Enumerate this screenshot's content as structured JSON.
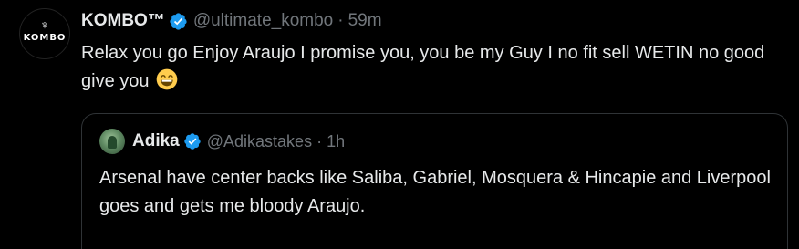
{
  "tweet": {
    "author": {
      "name": "KOMBO™",
      "handle": "@ultimate_kombo",
      "avatar_text": "KOMBO",
      "avatar_icon": "palm-tree-icon"
    },
    "separator": "·",
    "time": "59m",
    "text": "Relax you go Enjoy Araujo I promise you, you be my Guy I no fit sell WETIN no good give you",
    "emoji": "grinning-face-with-smiling-eyes"
  },
  "quote": {
    "author": {
      "name": "Adika",
      "handle": "@Adikastakes"
    },
    "separator": "·",
    "time": "1h",
    "text": "Arsenal have center backs like Saliba, Gabriel, Mosquera & Hincapie and Liverpool goes and gets me bloody Araujo."
  },
  "colors": {
    "background": "#000000",
    "text_primary": "#e7e9ea",
    "text_secondary": "#71767b",
    "verified_blue": "#1d9bf0",
    "border": "#2f3336"
  }
}
